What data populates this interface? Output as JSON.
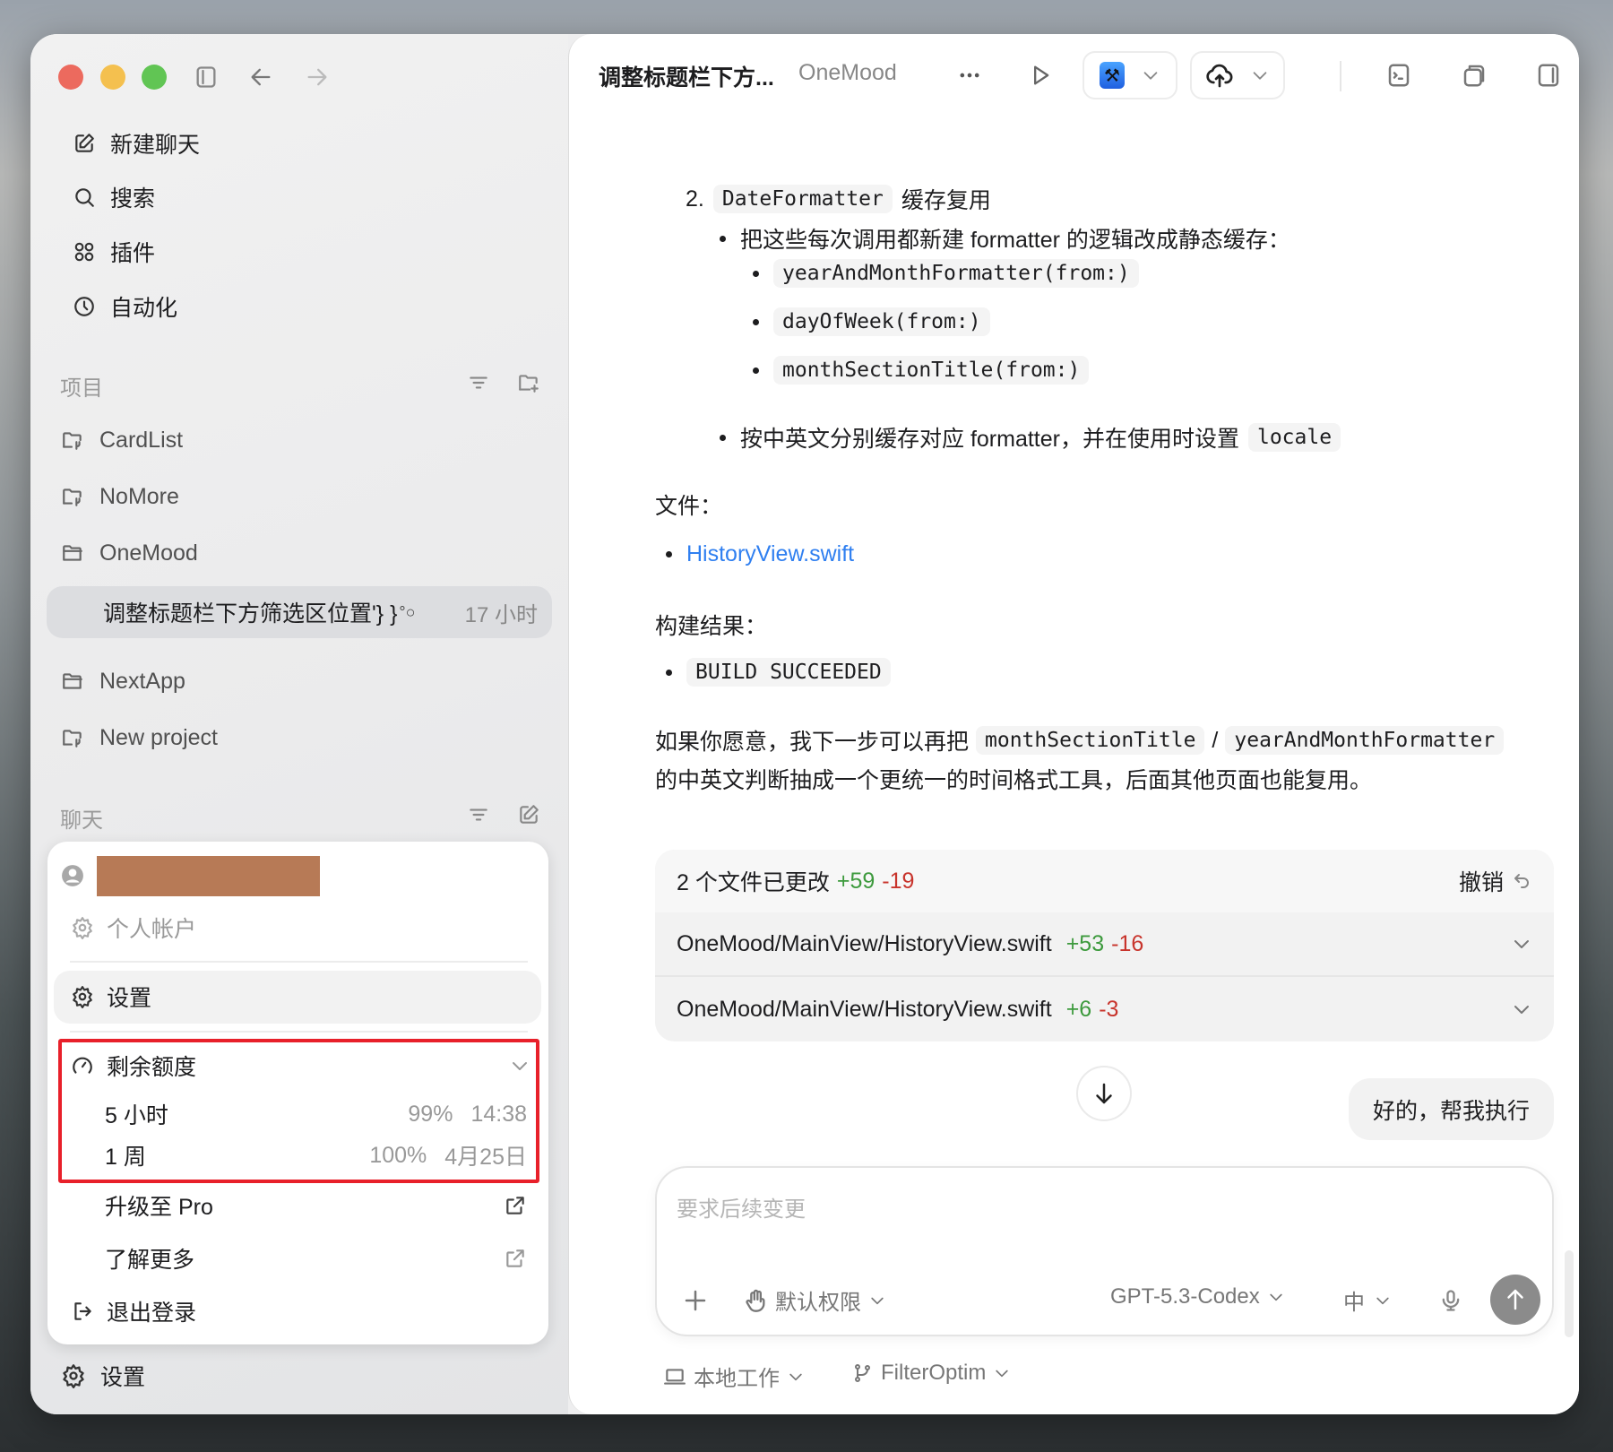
{
  "sidebar": {
    "nav": [
      {
        "label": "新建聊天",
        "icon": "edit-icon"
      },
      {
        "label": "搜索",
        "icon": "search-icon"
      },
      {
        "label": "插件",
        "icon": "plugins-icon"
      },
      {
        "label": "自动化",
        "icon": "clock-icon"
      }
    ],
    "projects_header": "项目",
    "projects": [
      "CardList",
      "NoMore",
      "OneMood"
    ],
    "active_chat": {
      "title": "调整标题栏下方筛选区位置'} }",
      "time": "17 小时"
    },
    "projects_more": [
      "NextApp",
      "New project"
    ],
    "chats_header": "聊天",
    "settings": "设置"
  },
  "menu": {
    "account": "个人帐户",
    "settings": "设置",
    "quota": {
      "title": "剩余额度",
      "rows": [
        {
          "label": "5 小时",
          "percent": "99%",
          "reset": "14:38"
        },
        {
          "label": "1 周",
          "percent": "100%",
          "reset": "4月25日"
        }
      ]
    },
    "upgrade": "升级至 Pro",
    "learn_more": "了解更多",
    "logout": "退出登录",
    "highlight_color": "#e8202a"
  },
  "header": {
    "title": "调整标题栏下方...",
    "project": "OneMood"
  },
  "content": {
    "item_num": "2.",
    "item_code": "DateFormatter",
    "item_text": "缓存复用",
    "bullet1": "把这些每次调用都新建 formatter 的逻辑改成静态缓存：",
    "subs": [
      "yearAndMonthFormatter(from:)",
      "dayOfWeek(from:)",
      "monthSectionTitle(from:)"
    ],
    "bullet2": "按中英文分别缓存对应 formatter，并在使用时设置",
    "bullet2_code": "locale",
    "files_label": "文件：",
    "file_link": "HistoryView.swift",
    "build_label": "构建结果：",
    "build_result": "BUILD SUCCEEDED",
    "para_a": "如果你愿意，我下一步可以再把",
    "para_code1": "monthSectionTitle",
    "para_sep": "/",
    "para_code2": "yearAndMonthFormatter",
    "para_b": "的中英文判断抽成一个更统一的时间格式工具，后面其他页面也能复用。"
  },
  "changes": {
    "summary": "2 个文件已更改",
    "add": "+59",
    "del": "-19",
    "undo": "撤销",
    "files": [
      {
        "path": "OneMood/MainView/HistoryView.swift",
        "add": "+53",
        "del": "-16"
      },
      {
        "path": "OneMood/MainView/HistoryView.swift",
        "add": "+6",
        "del": "-3"
      }
    ]
  },
  "user_message": "好的，帮我执行",
  "composer": {
    "placeholder": "要求后续变更",
    "permission": "默认权限",
    "model": "GPT-5.3-Codex",
    "effort": "中"
  },
  "footer": {
    "workspace": "本地工作",
    "branch": "FilterOptim"
  }
}
